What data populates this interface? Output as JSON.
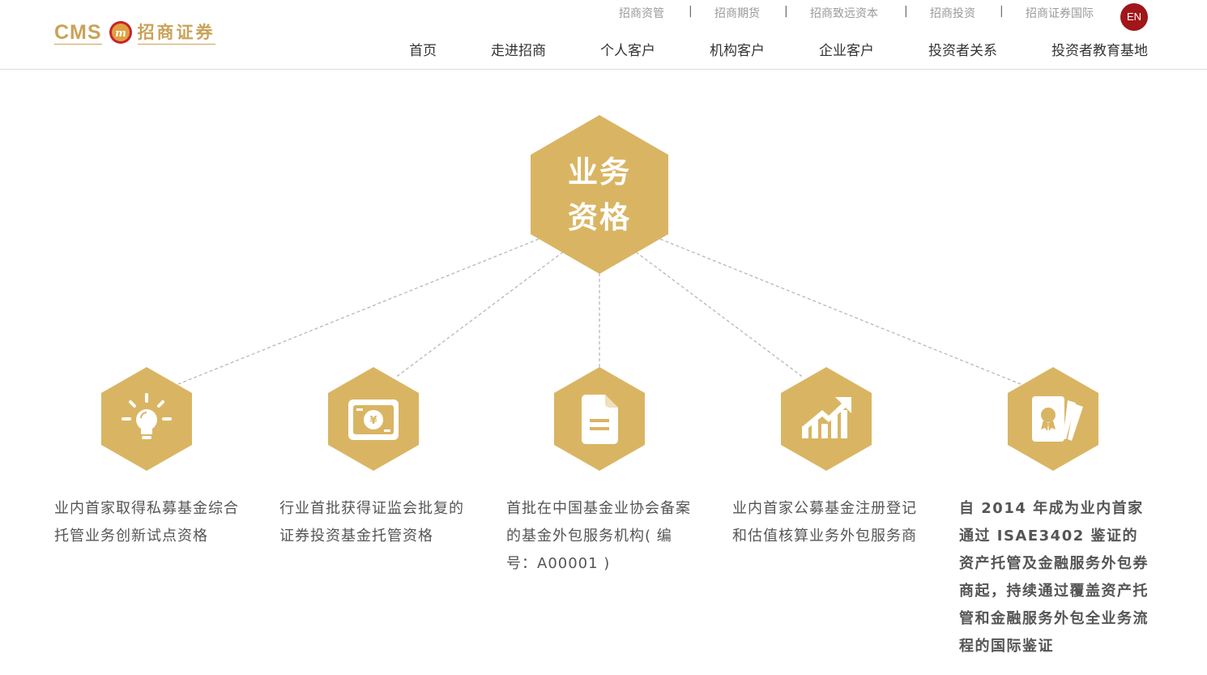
{
  "brand": {
    "latin": "CMS",
    "chinese": "招商证券",
    "accent": "#c9a35a"
  },
  "topbar": {
    "links": [
      "招商资管",
      "招商期货",
      "招商致远资本",
      "招商投资",
      "招商证券国际"
    ],
    "separator": "|",
    "lang_label": "EN"
  },
  "nav": [
    "首页",
    "走进招商",
    "个人客户",
    "机构客户",
    "企业客户",
    "投资者关系",
    "投资者教育基地"
  ],
  "diagram": {
    "center": {
      "line1": "业务",
      "line2": "资格"
    },
    "items": [
      {
        "icon": "lightbulb-icon",
        "text": "业内首家取得私募基金综合托管业务创新试点资格"
      },
      {
        "icon": "money-card-icon",
        "text": "行业首批获得证监会批复的证券投资基金托管资格"
      },
      {
        "icon": "document-icon",
        "text": "首批在中国基金业协会备案的基金外包服务机构( 编号：A00001 )"
      },
      {
        "icon": "rising-chart-icon",
        "text": "业内首家公募基金注册登记和估值核算业务外包服务商"
      },
      {
        "icon": "certificate-icon",
        "text": "自 2014 年成为业内首家通过 ISAE3402 鉴证的资产托管及金融服务外包券商起，持续通过覆盖资产托管和金融服务外包全业务流程的国际鉴证"
      }
    ],
    "hex_color": "#d9b563",
    "lang_color": "#a0161a"
  }
}
